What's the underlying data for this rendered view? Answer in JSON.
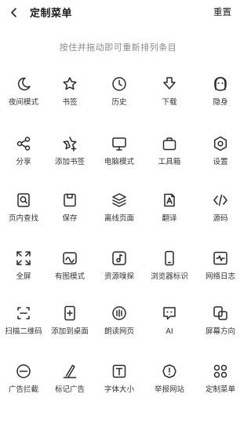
{
  "header": {
    "back_icon": "chevron-left-icon",
    "title": "定制菜单",
    "reset_label": "重置"
  },
  "hint": "按住并拖动即可重新排列条目",
  "menu_items": [
    {
      "label": "夜间模式",
      "icon": "moon-icon"
    },
    {
      "label": "书签",
      "icon": "star-icon"
    },
    {
      "label": "历史",
      "icon": "clock-icon"
    },
    {
      "label": "下载",
      "icon": "download-arrow-icon"
    },
    {
      "label": "隐身",
      "icon": "ghost-icon"
    },
    {
      "label": "分享",
      "icon": "share-icon"
    },
    {
      "label": "添加书签",
      "icon": "star-plus-icon"
    },
    {
      "label": "电脑模式",
      "icon": "monitor-icon"
    },
    {
      "label": "工具箱",
      "icon": "toolbox-icon"
    },
    {
      "label": "设置",
      "icon": "settings-hexagon-icon"
    },
    {
      "label": "页内查找",
      "icon": "find-in-page-icon"
    },
    {
      "label": "保存",
      "icon": "save-icon"
    },
    {
      "label": "离线页面",
      "icon": "layers-icon"
    },
    {
      "label": "翻译",
      "icon": "translate-icon"
    },
    {
      "label": "源码",
      "icon": "code-icon"
    },
    {
      "label": "全屏",
      "icon": "fullscreen-icon"
    },
    {
      "label": "有图模式",
      "icon": "image-mode-icon"
    },
    {
      "label": "资源嗅探",
      "icon": "music-note-icon"
    },
    {
      "label": "浏览器标识",
      "icon": "phone-icon"
    },
    {
      "label": "网络日志",
      "icon": "pulse-icon"
    },
    {
      "label": "扫描二维码",
      "icon": "scan-icon"
    },
    {
      "label": "添加到桌面",
      "icon": "add-to-desktop-icon"
    },
    {
      "label": "朗读网页",
      "icon": "read-aloud-icon"
    },
    {
      "label": "AI",
      "icon": "ai-chat-icon"
    },
    {
      "label": "屏幕方向",
      "icon": "screen-rotation-icon"
    },
    {
      "label": "广告拦截",
      "icon": "block-icon"
    },
    {
      "label": "标记广告",
      "icon": "pen-icon"
    },
    {
      "label": "字体大小",
      "icon": "font-size-icon"
    },
    {
      "label": "举报网站",
      "icon": "report-icon"
    },
    {
      "label": "定制菜单",
      "icon": "grid-custom-icon"
    }
  ]
}
